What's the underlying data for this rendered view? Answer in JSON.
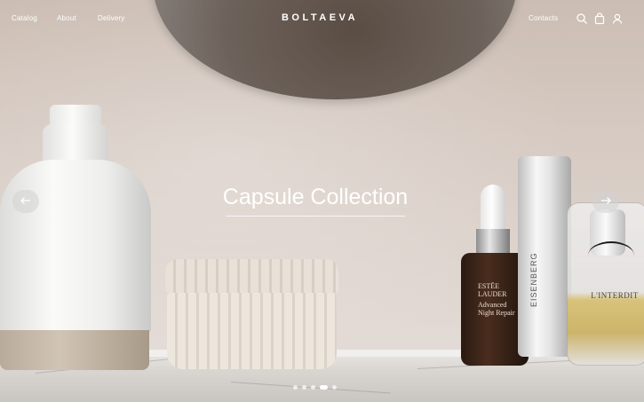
{
  "nav": {
    "brand": "BOLTAEVA",
    "links": [
      {
        "label": "Catalog"
      },
      {
        "label": "About"
      },
      {
        "label": "Delivery"
      }
    ],
    "contacts_label": "Contacts",
    "icons": [
      "search-icon",
      "cart-icon",
      "user-icon"
    ]
  },
  "hero": {
    "headline": "Capsule Collection",
    "prev_icon": "arrow-left-icon",
    "next_icon": "arrow-right-icon",
    "carousel": {
      "total": 5,
      "active_index": 3
    }
  },
  "products": {
    "serum_label": [
      "ESTĒE",
      "LAUDER",
      "Advanced",
      "Night Repair"
    ],
    "tube_label": "EISENBERG",
    "perfume_label": "L'INTERDIT"
  },
  "colors": {
    "text": "#ffffff",
    "wall": "#d6cac2",
    "arrow_bg": "#d2d2d2"
  }
}
